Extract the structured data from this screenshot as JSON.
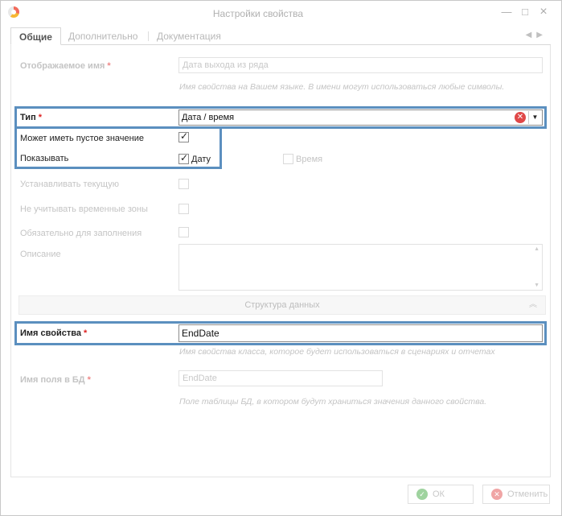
{
  "window": {
    "title": "Настройки свойства",
    "controls": {
      "close": "×",
      "minimize": "—",
      "maximize": "□"
    }
  },
  "tabs": [
    {
      "label": "Общие",
      "active": true
    },
    {
      "label": "Дополнительно",
      "active": false
    },
    {
      "label": "Документация",
      "active": false
    }
  ],
  "tab_scroll": {
    "left": "◀",
    "right": "▶"
  },
  "fields": {
    "display_name": {
      "label": "Отображаемое имя",
      "required_mark": "*",
      "placeholder": "Дата выхода из ряда",
      "hint": "Имя свойства на Вашем языке. В имени могут использоваться любые символы."
    },
    "type": {
      "label": "Тип",
      "required_mark": "*",
      "value": "Дата / время"
    },
    "can_be_empty": {
      "label": "Может иметь пустое значение",
      "checked": true
    },
    "show": {
      "label": "Показывать",
      "options": [
        {
          "label": "Дату",
          "checked": true
        },
        {
          "label": "Время",
          "checked": false
        }
      ]
    },
    "set_current": {
      "label": "Устанавливать текущую",
      "checked": false
    },
    "ignore_timezones": {
      "label": "Не учитывать временные зоны",
      "checked": false
    },
    "required": {
      "label": "Обязательно для заполнения",
      "checked": false
    },
    "description": {
      "label": "Описание",
      "value": ""
    },
    "property_name": {
      "label": "Имя свойства",
      "required_mark": "*",
      "value": "EndDate",
      "hint": "Имя свойства класса, которое будет использоваться в сценариях и отчетах"
    },
    "db_field_name": {
      "label": "Имя поля в БД",
      "required_mark": "*",
      "value": "EndDate",
      "hint": "Поле таблицы БД, в котором будут храниться значения данного свойства."
    }
  },
  "section": {
    "label": "Структура данных",
    "chevron": "»"
  },
  "checkmark": "✓",
  "buttons": {
    "ok": {
      "label": "ОК",
      "icon": "check-circle-icon",
      "color": "#9fd39f"
    },
    "cancel": {
      "label": "Отменить",
      "icon": "cancel-circle-icon",
      "color": "#f0a5a5"
    }
  },
  "colors": {
    "highlight": "#5b8fbf",
    "required": "#d22222"
  }
}
